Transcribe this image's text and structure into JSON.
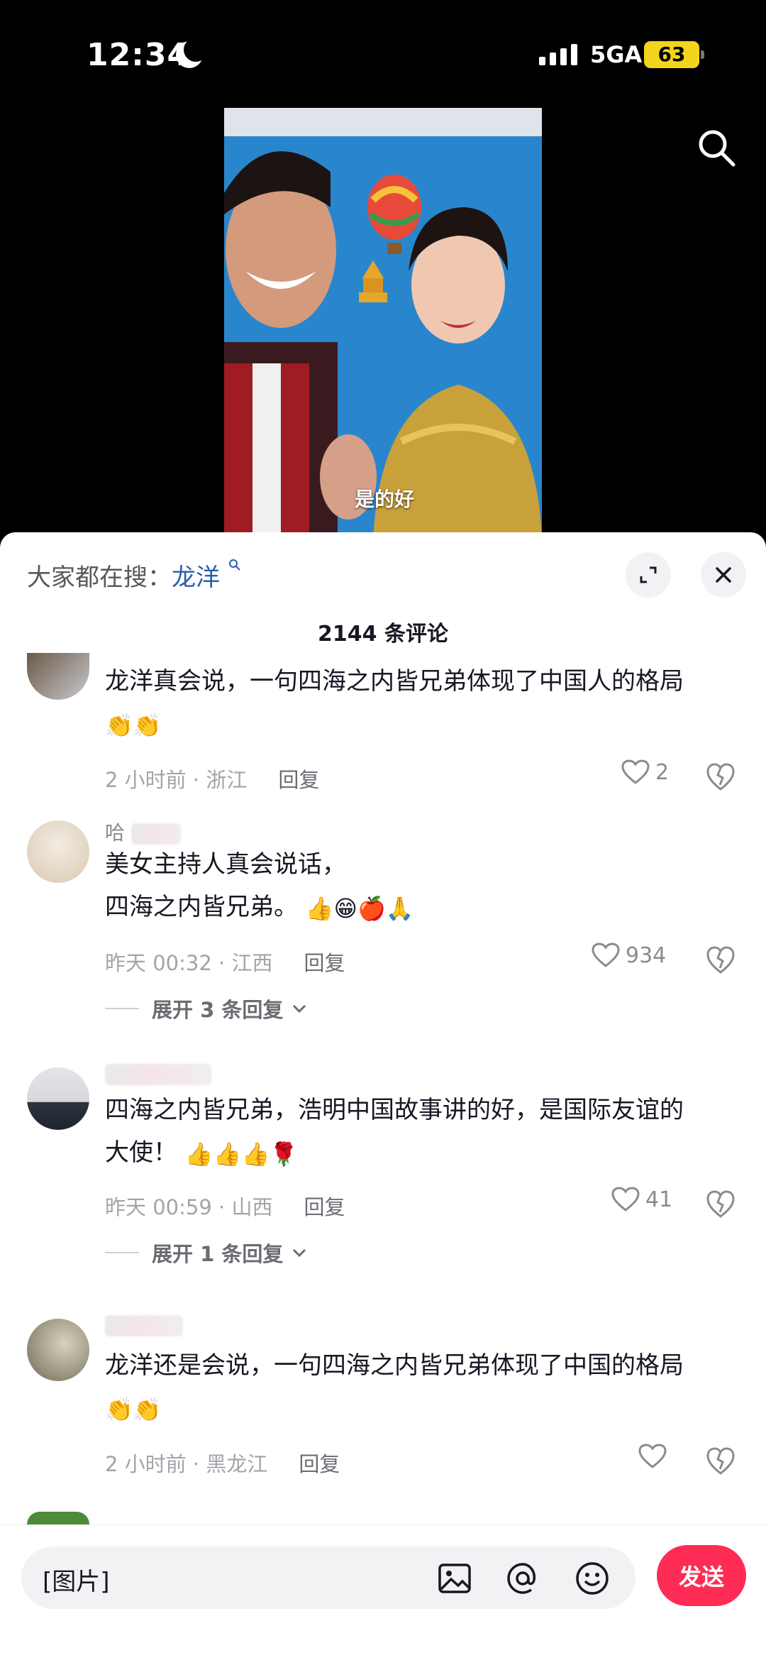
{
  "status_bar": {
    "time": "12:34",
    "network": "5GA",
    "battery": "63"
  },
  "video": {
    "caption": "是的好"
  },
  "sheet": {
    "hot_search_label": "大家都在搜：",
    "hot_search_keyword": "龙洋",
    "comment_count_title": "2144 条评论"
  },
  "comments": [
    {
      "username": "",
      "text": "龙洋真会说，一句四海之内皆兄弟体现了中国人的格局",
      "emojis": "👏👏",
      "time": "2 小时前",
      "location": "浙江",
      "reply_label": "回复",
      "likes": "2"
    },
    {
      "username": "哈",
      "text_line1": "美女主持人真会说话，",
      "text_line2": "四海之内皆兄弟。",
      "emojis": "👍😁🍎🙏",
      "time": "昨天 00:32",
      "location": "江西",
      "reply_label": "回复",
      "likes": "934",
      "expand_label": "展开 3 条回复"
    },
    {
      "username": "",
      "text_line1": "四海之内皆兄弟，浩明中国故事讲的好，是国际友谊的",
      "text_line2": "大使！",
      "emojis": "👍👍👍🌹",
      "time": "昨天 00:59",
      "location": "山西",
      "reply_label": "回复",
      "likes": "41",
      "expand_label": "展开 1 条回复"
    },
    {
      "username": "",
      "text": "龙洋还是会说，一句四海之内皆兄弟体现了中国的格局",
      "emojis": "👏👏",
      "time": "2 小时前",
      "location": "黑龙江",
      "reply_label": "回复",
      "likes": ""
    }
  ],
  "input_bar": {
    "value": "[图片]",
    "send_label": "发送",
    "icons": [
      "image-icon",
      "at-icon",
      "emoji-icon"
    ]
  },
  "colors": {
    "accent": "#fe2c55",
    "keyword": "#2a5db0",
    "battery": "#f2d51c"
  }
}
